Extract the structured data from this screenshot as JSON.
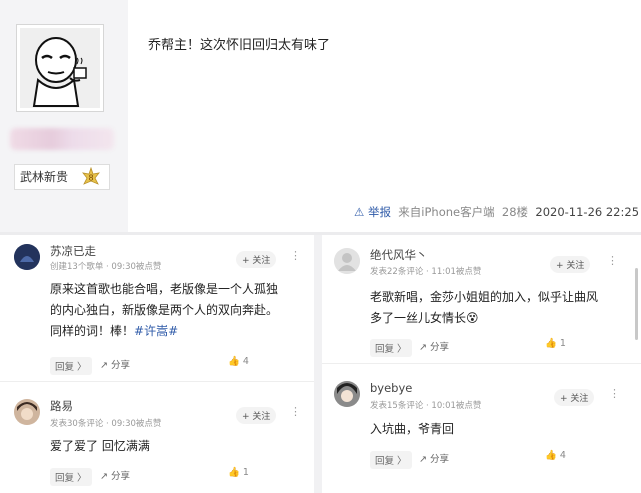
{
  "post": {
    "text": "乔帮主！这次怀旧回归太有味了",
    "user_tag": "武林新贵",
    "level": "8",
    "report": "举报",
    "source": "来自iPhone客户端",
    "floor": "28楼",
    "time": "2020-11-26 22:25"
  },
  "comments_left": [
    {
      "name": "苏凉已走",
      "meta": "创建13个歌单 · 09:30被点赞",
      "follow": "+ 关注",
      "lines": [
        "原来这首歌也能合唱，老版像是一个人孤独",
        "的内心独白，新版像是两个人的双向奔赴。",
        "同样的词！棒！"
      ],
      "hashtag": "#许嵩#",
      "reply": "回复 〉",
      "share": "分享",
      "likes": "4"
    },
    {
      "name": "路易",
      "meta": "发表30条评论 · 09:30被点赞",
      "follow": "+ 关注",
      "lines": [
        "爱了爱了 回忆满满"
      ],
      "reply": "回复 〉",
      "share": "分享",
      "likes": "1"
    }
  ],
  "comments_right": [
    {
      "name": "绝代风华丶",
      "meta": "发表22条评论 · 11:01被点赞",
      "follow": "+ 关注",
      "lines": [
        "老歌新唱，金莎小姐姐的加入，似乎让曲风",
        "多了一丝儿女情长"
      ],
      "emoji": "😵",
      "reply": "回复 〉",
      "share": "分享",
      "likes": "1"
    },
    {
      "name": "byebye",
      "meta": "发表15条评论 · 10:01被点赞",
      "follow": "+ 关注",
      "lines": [
        "入坑曲，爷青回"
      ],
      "reply": "回复 〉",
      "share": "分享",
      "likes": "4"
    }
  ],
  "colors": {
    "link": "#2e5aa8",
    "badge": "#e7c24a"
  }
}
